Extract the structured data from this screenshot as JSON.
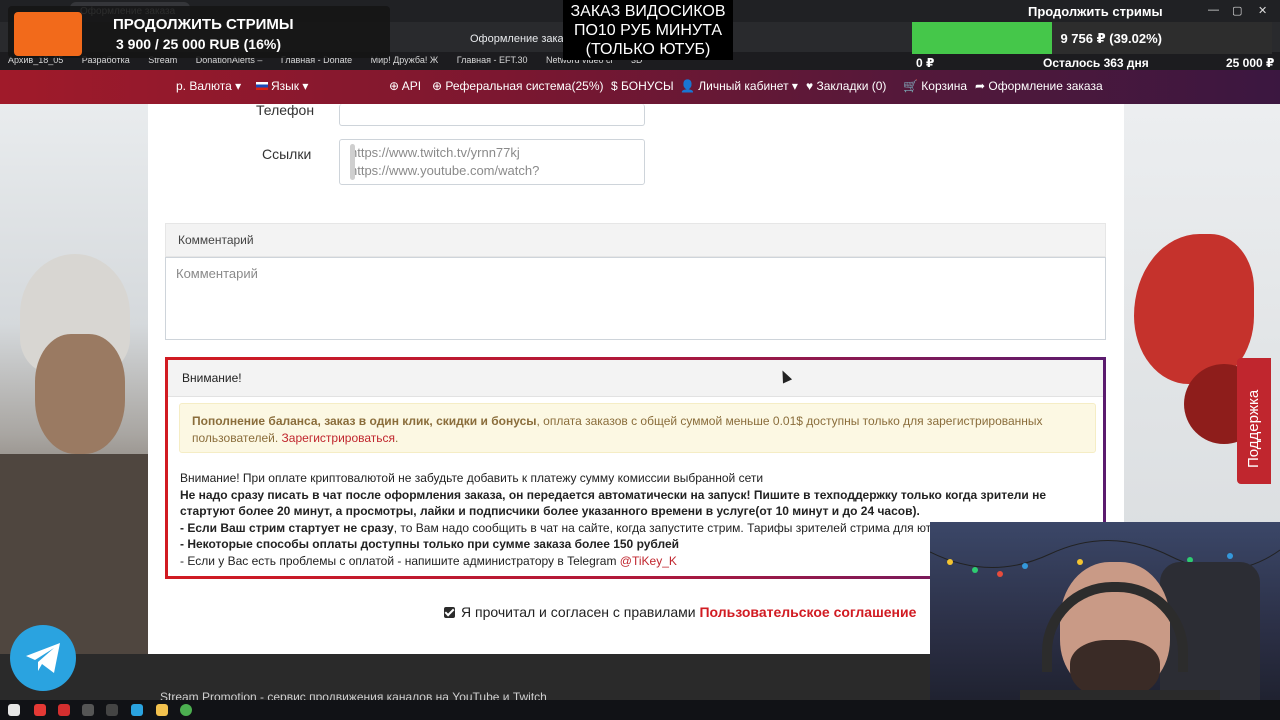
{
  "browser": {
    "tabs": [
      "Оформление заказа"
    ],
    "address": "Оформление заказа",
    "bookmarks": [
      "Архив_18_05",
      "Разработка",
      "Stream",
      "DonationAlerts –",
      "Главная - Donate",
      "Мир! Дружба! Ж",
      "Главная - EFT.30",
      "Netword video cl",
      "3D"
    ]
  },
  "overlay": {
    "left_title": "ПРОДОЛЖИТЬ СТРИМЫ",
    "left_amount": "3 900 / 25 000 RUB (16%)",
    "center_text": "ЗАКАЗ ВИДОСИКОВ ПО10 РУБ МИНУТА (ТОЛЬКО ЮТУБ)",
    "right_title": "Продолжить стримы",
    "goal_label": "9 756 ₽ (39.02%)",
    "goal_progress": 0.3902,
    "goal_min": "0 ₽",
    "goal_remaining": "Осталось 363 дня",
    "goal_max": "25 000 ₽"
  },
  "nav": {
    "currency": "р. Валюта ▾",
    "language": "Язык ▾",
    "api": "⊕ API",
    "referral": "⊕ Реферальная система(25%)",
    "bonuses": "$ БОНУСЫ",
    "cabinet": "Личный кабинет ▾",
    "bookmarks": "♥ Закладки (0)",
    "cart": "Корзина",
    "checkout": "Оформление заказа"
  },
  "form": {
    "phone_label": "Телефон",
    "links_label": "Ссылки",
    "links_line1": "https://www.twitch.tv/yrnn77kj",
    "links_line2": "https://www.youtube.com/watch?",
    "comment_header": "Комментарий",
    "comment_placeholder": "Комментарий"
  },
  "attention": {
    "title": "Внимание!",
    "warn_bold": "Пополнение баланса, заказ в один клик, скидки и бонусы",
    "warn_text": ", оплата заказов с общей суммой меньше 0.01$ доступны только для зарегистрированных пользователей.",
    "warn_link": "Зарегистрироваться",
    "line1": "Внимание! При оплате криптовалютой не забудьте добавить к платежу сумму комиссии выбранной сети",
    "line2": "Не надо сразу писать в чат после оформления заказа, он передается автоматически на запуск! Пишите в техподдержку только когда зрители не стартуют более 20 минут, а просмотры, лайки и подписчики более указанного времени в услуге(от 10 минут и до 24 часов).",
    "line3_bold": "- Если Ваш стрим стартует не сразу",
    "line3_rest": ", то Вам надо сообщить в чат на сайте, когда запустите стрим. Тарифы зрителей стрима для ютуба",
    "line4": "- Некоторые способы оплаты доступны только при сумме заказа более 150 рублей",
    "line5": "- Если у Вас есть проблемы с оплатой - напишите администратору в Telegram",
    "line5_link": "@TiKey_K"
  },
  "agreement": {
    "text": "Я прочитал и согласен с правилами",
    "link": "Пользовательское соглашение"
  },
  "support_label": "Поддержка",
  "footer_text": "Stream Promotion - сервис продвижения каналов на YouTube и Twitch",
  "colors": {
    "accent_red": "#d11b22",
    "nav_start": "#a01a2a",
    "nav_end": "#3b1740",
    "goal_fill": "#45c74a",
    "warning_bg": "#fcf8e3"
  }
}
